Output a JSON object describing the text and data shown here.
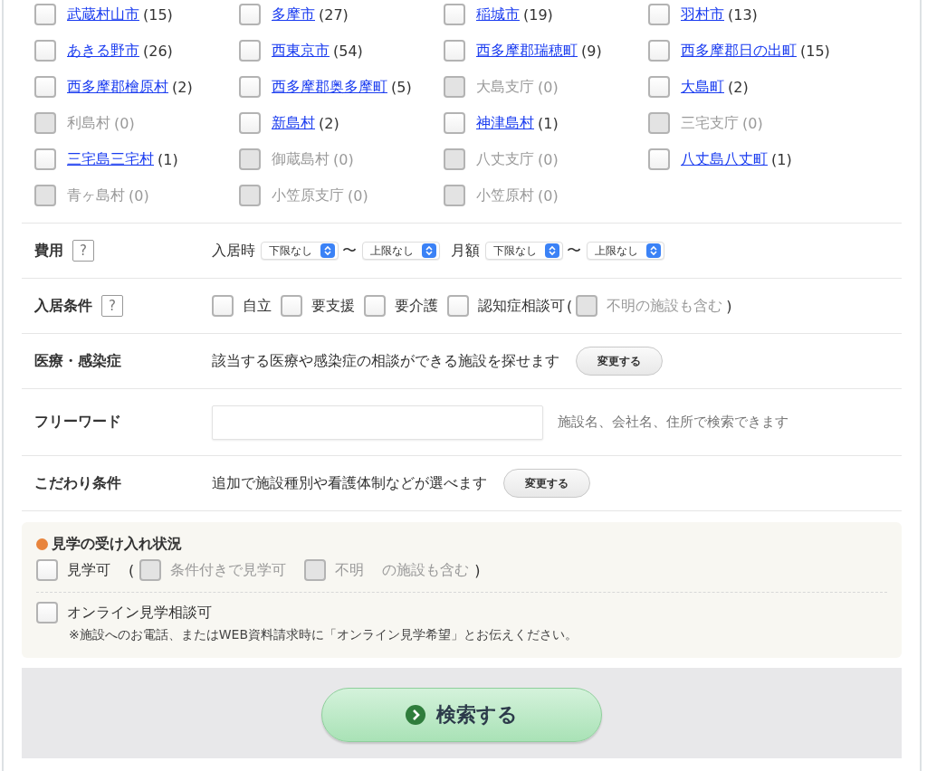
{
  "areas": [
    {
      "name": "武蔵村山市",
      "count": "(15)",
      "disabled": false,
      "checked": false
    },
    {
      "name": "多摩市",
      "count": "(27)",
      "disabled": false,
      "checked": false
    },
    {
      "name": "稲城市",
      "count": "(19)",
      "disabled": false,
      "checked": false
    },
    {
      "name": "羽村市",
      "count": "(13)",
      "disabled": false,
      "checked": false
    },
    {
      "name": "あきる野市",
      "count": "(26)",
      "disabled": false,
      "checked": false
    },
    {
      "name": "西東京市",
      "count": "(54)",
      "disabled": false,
      "checked": false
    },
    {
      "name": "西多摩郡瑞穂町",
      "count": "(9)",
      "disabled": false,
      "checked": false
    },
    {
      "name": "西多摩郡日の出町",
      "count": "(15)",
      "disabled": false,
      "checked": false
    },
    {
      "name": "西多摩郡檜原村",
      "count": "(2)",
      "disabled": false,
      "checked": false
    },
    {
      "name": "西多摩郡奥多摩町",
      "count": "(5)",
      "disabled": false,
      "checked": false
    },
    {
      "name": "大島支庁",
      "count": "(0)",
      "disabled": true,
      "checked": false
    },
    {
      "name": "大島町",
      "count": "(2)",
      "disabled": false,
      "checked": false
    },
    {
      "name": "利島村",
      "count": "(0)",
      "disabled": true,
      "checked": false
    },
    {
      "name": "新島村",
      "count": "(2)",
      "disabled": false,
      "checked": false
    },
    {
      "name": "神津島村",
      "count": "(1)",
      "disabled": false,
      "checked": false
    },
    {
      "name": "三宅支庁",
      "count": "(0)",
      "disabled": true,
      "checked": false
    },
    {
      "name": "三宅島三宅村",
      "count": "(1)",
      "disabled": false,
      "checked": false
    },
    {
      "name": "御蔵島村",
      "count": "(0)",
      "disabled": true,
      "checked": false
    },
    {
      "name": "八丈支庁",
      "count": "(0)",
      "disabled": true,
      "checked": false
    },
    {
      "name": "八丈島八丈町",
      "count": "(1)",
      "disabled": false,
      "checked": false
    },
    {
      "name": "青ヶ島村",
      "count": "(0)",
      "disabled": true,
      "checked": false
    },
    {
      "name": "小笠原支庁",
      "count": "(0)",
      "disabled": true,
      "checked": false
    },
    {
      "name": "小笠原村",
      "count": "(0)",
      "disabled": true,
      "checked": false
    }
  ],
  "cost": {
    "label": "費用",
    "help": "?",
    "ranges": [
      {
        "label": "入居時",
        "from": "下限なし",
        "separator": "〜",
        "to": "上限なし"
      },
      {
        "label": "月額",
        "from": "下限なし",
        "separator": "〜",
        "to": "上限なし"
      }
    ]
  },
  "conditions": {
    "label": "入居条件",
    "help": "?",
    "items": [
      {
        "kind": "check",
        "label": "自立",
        "checked": false,
        "disabled": false
      },
      {
        "kind": "check",
        "label": "要支援",
        "checked": false,
        "disabled": false
      },
      {
        "kind": "check",
        "label": "要介護",
        "checked": false,
        "disabled": false
      },
      {
        "kind": "check",
        "label": "認知症相談可",
        "checked": false,
        "disabled": false
      },
      {
        "kind": "text",
        "label": "(",
        "disabled": false
      },
      {
        "kind": "check",
        "label": "不明の施設も含む",
        "checked": false,
        "disabled": true
      },
      {
        "kind": "text",
        "label": ")",
        "disabled": false
      }
    ]
  },
  "medical": {
    "label": "医療・感染症",
    "text": "該当する医療や感染症の相談ができる施設を探せます",
    "button": "変更する"
  },
  "freeword": {
    "label": "フリーワード",
    "hint": "施設名、会社名、住所で検索できます"
  },
  "preferences": {
    "label": "こだわり条件",
    "text": "追加で施設種別や看護体制などが選べます",
    "button": "変更する"
  },
  "visit": {
    "title": "見学の受け入れ状況",
    "items": [
      {
        "kind": "check",
        "label": "見学可",
        "checked": false,
        "disabled": false
      },
      {
        "kind": "text",
        "label": "(",
        "disabled": false
      },
      {
        "kind": "check",
        "label": "条件付きで見学可",
        "checked": false,
        "disabled": true
      },
      {
        "kind": "check",
        "label": "不明",
        "checked": false,
        "disabled": true
      },
      {
        "kind": "text",
        "label": "の施設も含む",
        "disabled": true
      },
      {
        "kind": "text",
        "label": ")",
        "disabled": false
      }
    ],
    "online": {
      "label": "オンライン見学相談可",
      "checked": false,
      "note": "※施設へのお電話、またはWEB資料請求時に「オンライン見学希望」とお伝えください。"
    }
  },
  "search_button": "検索する"
}
